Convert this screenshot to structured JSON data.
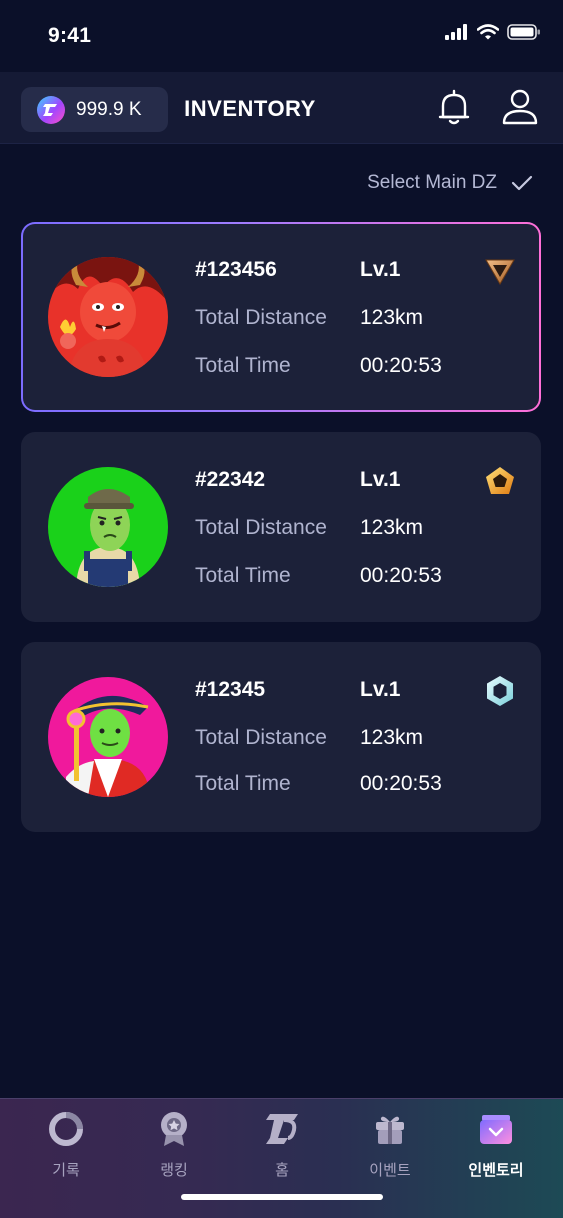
{
  "status": {
    "time": "9:41"
  },
  "header": {
    "balance": "999.9 K",
    "title": "INVENTORY",
    "bell_icon": "bell-icon",
    "user_icon": "user-icon"
  },
  "select_main": {
    "label": "Select Main DZ",
    "icon": "check-icon"
  },
  "labels": {
    "distance": "Total Distance",
    "time": "Total Time"
  },
  "cards": [
    {
      "id": "#123456",
      "level": "Lv.1",
      "distance": "123km",
      "time": "00:20:53",
      "grade": "bronze-triangle-icon",
      "selected": true
    },
    {
      "id": "#22342",
      "level": "Lv.1",
      "distance": "123km",
      "time": "00:20:53",
      "grade": "gold-pentagon-icon",
      "selected": false
    },
    {
      "id": "#12345",
      "level": "Lv.1",
      "distance": "123km",
      "time": "00:20:53",
      "grade": "diamond-hexagon-icon",
      "selected": false
    }
  ],
  "tabs": [
    {
      "label": "기록",
      "icon": "record-pie-icon",
      "active": false
    },
    {
      "label": "랭킹",
      "icon": "ranking-medal-icon",
      "active": false
    },
    {
      "label": "홈",
      "icon": "home-logo-icon",
      "active": false
    },
    {
      "label": "이벤트",
      "icon": "event-gift-icon",
      "active": false
    },
    {
      "label": "인벤토리",
      "icon": "inventory-box-icon",
      "active": true
    }
  ],
  "colors": {
    "background": "#0b1029",
    "card": "#1c2139",
    "accent_gradient_start": "#7c6cff",
    "accent_gradient_end": "#ff6fd8"
  }
}
